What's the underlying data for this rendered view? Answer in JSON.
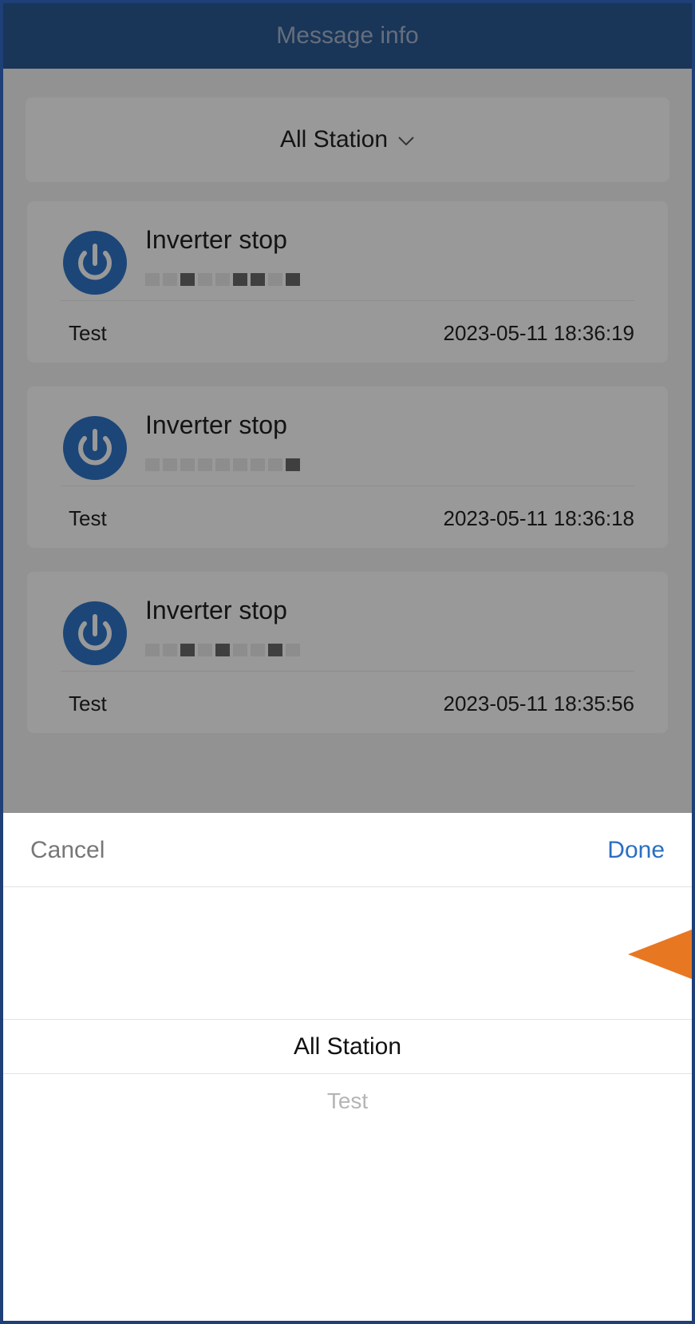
{
  "header": {
    "title": "Message info"
  },
  "filter": {
    "label": "All Station",
    "chevron_icon": "chevron-down-icon"
  },
  "messages": [
    {
      "title": "Inverter stop",
      "station": "Test",
      "time": "2023-05-11 18:36:19",
      "icon": "power-icon"
    },
    {
      "title": "Inverter stop",
      "station": "Test",
      "time": "2023-05-11 18:36:18",
      "icon": "power-icon"
    },
    {
      "title": "Inverter stop",
      "station": "Test",
      "time": "2023-05-11 18:35:56",
      "icon": "power-icon"
    }
  ],
  "picker": {
    "cancel_label": "Cancel",
    "done_label": "Done",
    "options": [
      "All Station",
      "Test"
    ],
    "selected_index": 0
  },
  "colors": {
    "header_bg": "#2b5a94",
    "accent": "#2b6fc1",
    "icon_blue": "#2f76c8",
    "pointer": "#e87722"
  }
}
